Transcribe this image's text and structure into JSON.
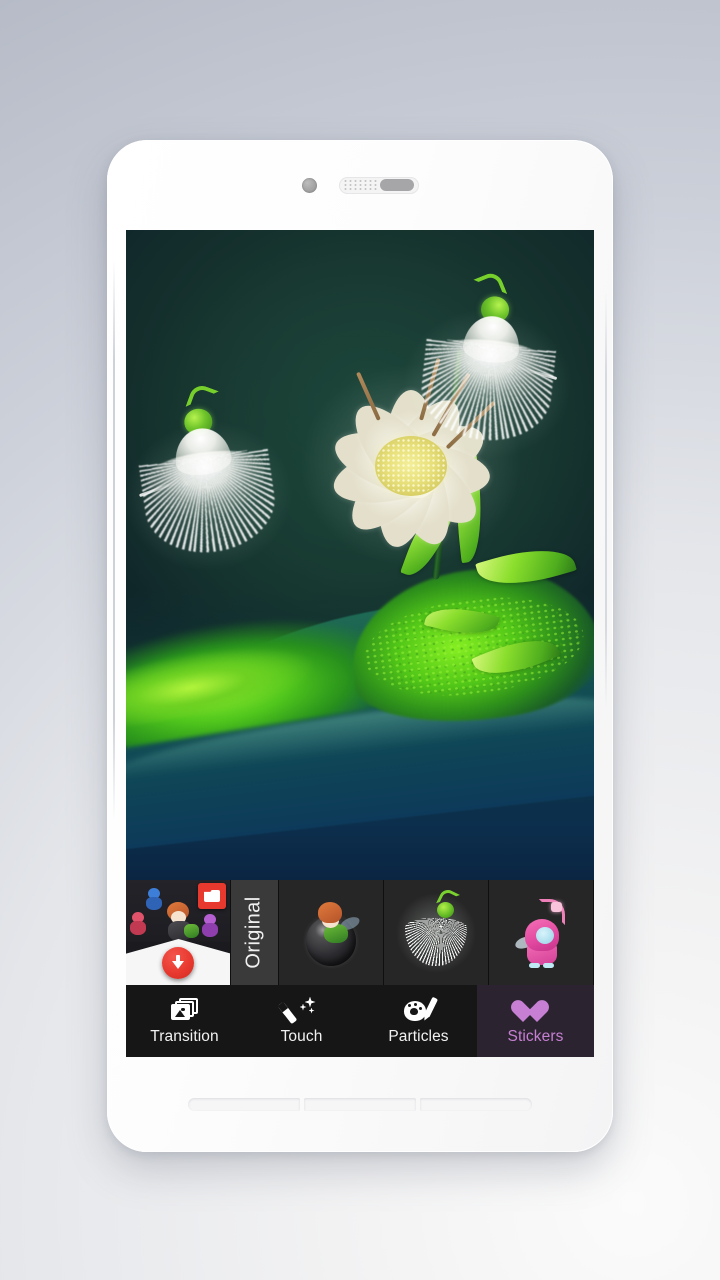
{
  "app": {
    "screen_name": "photo-editor-stickers"
  },
  "photo": {
    "description": "White night-blooming cereus flower on dark green background with mossy log",
    "applied_stickers": [
      "white-feather-fairy",
      "white-feather-fairy"
    ]
  },
  "sticker_strip": {
    "more_tile": {
      "name": "more-stickers",
      "badge_icon": "folder-icon",
      "action_icon": "download-arrow-icon"
    },
    "original_label": "Original",
    "items": [
      {
        "id": "bubble-fairy",
        "icon": "bubble-fairy-sticker"
      },
      {
        "id": "white-fairy",
        "icon": "white-feather-fairy-sticker"
      },
      {
        "id": "pink-fairy",
        "icon": "pink-fairy-sticker"
      }
    ]
  },
  "tabbar": {
    "tabs": [
      {
        "label": "Transition",
        "icon": "photos-stack-icon",
        "active": false
      },
      {
        "label": "Touch",
        "icon": "magic-wand-icon",
        "active": false
      },
      {
        "label": "Particles",
        "icon": "palette-brush-icon",
        "active": false
      },
      {
        "label": "Stickers",
        "icon": "heart-icon",
        "active": true
      }
    ],
    "active_color": "#c77fd4",
    "inactive_color": "#f2f2f2",
    "background": "#161616",
    "active_background": "#2b2430"
  }
}
